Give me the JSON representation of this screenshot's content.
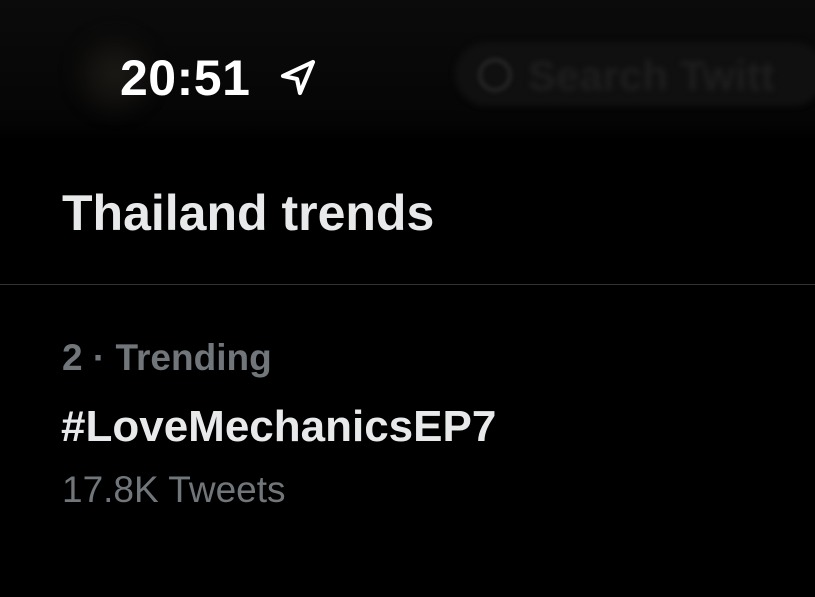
{
  "status_bar": {
    "time": "20:51",
    "location_icon": "location-arrow-icon"
  },
  "header": {
    "search_icon": "search-icon",
    "search_placeholder": "Search Twitt"
  },
  "section": {
    "title": "Thailand trends"
  },
  "trends": [
    {
      "meta": "2 · Trending",
      "name": "#LoveMechanicsEP7",
      "tweet_count": "17.8K Tweets"
    }
  ],
  "colors": {
    "background": "#000000",
    "primary_text": "#e7e9ea",
    "secondary_text": "#71767b",
    "divider": "#2f3336"
  }
}
